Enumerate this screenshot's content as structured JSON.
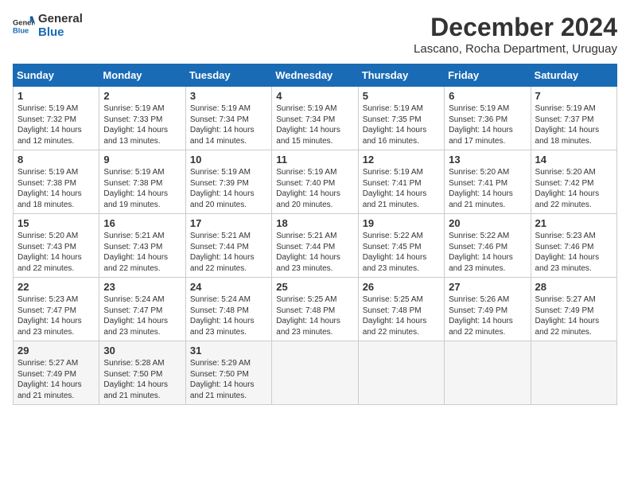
{
  "logo": {
    "general": "General",
    "blue": "Blue"
  },
  "title": {
    "month": "December 2024",
    "location": "Lascano, Rocha Department, Uruguay"
  },
  "weekdays": [
    "Sunday",
    "Monday",
    "Tuesday",
    "Wednesday",
    "Thursday",
    "Friday",
    "Saturday"
  ],
  "weeks": [
    [
      {
        "day": "1",
        "sunrise": "5:19 AM",
        "sunset": "7:32 PM",
        "daylight": "14 hours and 12 minutes."
      },
      {
        "day": "2",
        "sunrise": "5:19 AM",
        "sunset": "7:33 PM",
        "daylight": "14 hours and 13 minutes."
      },
      {
        "day": "3",
        "sunrise": "5:19 AM",
        "sunset": "7:34 PM",
        "daylight": "14 hours and 14 minutes."
      },
      {
        "day": "4",
        "sunrise": "5:19 AM",
        "sunset": "7:34 PM",
        "daylight": "14 hours and 15 minutes."
      },
      {
        "day": "5",
        "sunrise": "5:19 AM",
        "sunset": "7:35 PM",
        "daylight": "14 hours and 16 minutes."
      },
      {
        "day": "6",
        "sunrise": "5:19 AM",
        "sunset": "7:36 PM",
        "daylight": "14 hours and 17 minutes."
      },
      {
        "day": "7",
        "sunrise": "5:19 AM",
        "sunset": "7:37 PM",
        "daylight": "14 hours and 18 minutes."
      }
    ],
    [
      {
        "day": "8",
        "sunrise": "5:19 AM",
        "sunset": "7:38 PM",
        "daylight": "14 hours and 18 minutes."
      },
      {
        "day": "9",
        "sunrise": "5:19 AM",
        "sunset": "7:38 PM",
        "daylight": "14 hours and 19 minutes."
      },
      {
        "day": "10",
        "sunrise": "5:19 AM",
        "sunset": "7:39 PM",
        "daylight": "14 hours and 20 minutes."
      },
      {
        "day": "11",
        "sunrise": "5:19 AM",
        "sunset": "7:40 PM",
        "daylight": "14 hours and 20 minutes."
      },
      {
        "day": "12",
        "sunrise": "5:19 AM",
        "sunset": "7:41 PM",
        "daylight": "14 hours and 21 minutes."
      },
      {
        "day": "13",
        "sunrise": "5:20 AM",
        "sunset": "7:41 PM",
        "daylight": "14 hours and 21 minutes."
      },
      {
        "day": "14",
        "sunrise": "5:20 AM",
        "sunset": "7:42 PM",
        "daylight": "14 hours and 22 minutes."
      }
    ],
    [
      {
        "day": "15",
        "sunrise": "5:20 AM",
        "sunset": "7:43 PM",
        "daylight": "14 hours and 22 minutes."
      },
      {
        "day": "16",
        "sunrise": "5:21 AM",
        "sunset": "7:43 PM",
        "daylight": "14 hours and 22 minutes."
      },
      {
        "day": "17",
        "sunrise": "5:21 AM",
        "sunset": "7:44 PM",
        "daylight": "14 hours and 22 minutes."
      },
      {
        "day": "18",
        "sunrise": "5:21 AM",
        "sunset": "7:44 PM",
        "daylight": "14 hours and 23 minutes."
      },
      {
        "day": "19",
        "sunrise": "5:22 AM",
        "sunset": "7:45 PM",
        "daylight": "14 hours and 23 minutes."
      },
      {
        "day": "20",
        "sunrise": "5:22 AM",
        "sunset": "7:46 PM",
        "daylight": "14 hours and 23 minutes."
      },
      {
        "day": "21",
        "sunrise": "5:23 AM",
        "sunset": "7:46 PM",
        "daylight": "14 hours and 23 minutes."
      }
    ],
    [
      {
        "day": "22",
        "sunrise": "5:23 AM",
        "sunset": "7:47 PM",
        "daylight": "14 hours and 23 minutes."
      },
      {
        "day": "23",
        "sunrise": "5:24 AM",
        "sunset": "7:47 PM",
        "daylight": "14 hours and 23 minutes."
      },
      {
        "day": "24",
        "sunrise": "5:24 AM",
        "sunset": "7:48 PM",
        "daylight": "14 hours and 23 minutes."
      },
      {
        "day": "25",
        "sunrise": "5:25 AM",
        "sunset": "7:48 PM",
        "daylight": "14 hours and 23 minutes."
      },
      {
        "day": "26",
        "sunrise": "5:25 AM",
        "sunset": "7:48 PM",
        "daylight": "14 hours and 22 minutes."
      },
      {
        "day": "27",
        "sunrise": "5:26 AM",
        "sunset": "7:49 PM",
        "daylight": "14 hours and 22 minutes."
      },
      {
        "day": "28",
        "sunrise": "5:27 AM",
        "sunset": "7:49 PM",
        "daylight": "14 hours and 22 minutes."
      }
    ],
    [
      {
        "day": "29",
        "sunrise": "5:27 AM",
        "sunset": "7:49 PM",
        "daylight": "14 hours and 21 minutes."
      },
      {
        "day": "30",
        "sunrise": "5:28 AM",
        "sunset": "7:50 PM",
        "daylight": "14 hours and 21 minutes."
      },
      {
        "day": "31",
        "sunrise": "5:29 AM",
        "sunset": "7:50 PM",
        "daylight": "14 hours and 21 minutes."
      },
      null,
      null,
      null,
      null
    ]
  ]
}
